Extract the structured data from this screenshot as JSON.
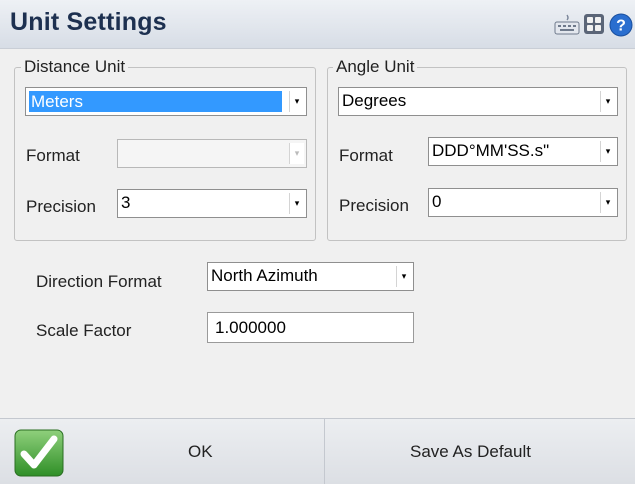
{
  "window": {
    "title": "Unit Settings"
  },
  "titlebar_icons": [
    "keyboard-icon",
    "apps-grid-icon",
    "help-icon"
  ],
  "distance": {
    "legend": "Distance Unit",
    "unit_value": "Meters",
    "format_label": "Format",
    "format_value": "",
    "precision_label": "Precision",
    "precision_value": "3"
  },
  "angle": {
    "legend": "Angle Unit",
    "unit_value": "Degrees",
    "format_label": "Format",
    "format_value": "DDD°MM'SS.s\"",
    "precision_label": "Precision",
    "precision_value": "0"
  },
  "direction": {
    "label": "Direction Format",
    "value": "North Azimuth"
  },
  "scale": {
    "label": "Scale Factor",
    "value": "1.000000"
  },
  "buttons": {
    "ok": "OK",
    "save_default": "Save As Default"
  },
  "colors": {
    "title": "#1d3050",
    "selection": "#3399ff",
    "check": "#3aa42e"
  }
}
